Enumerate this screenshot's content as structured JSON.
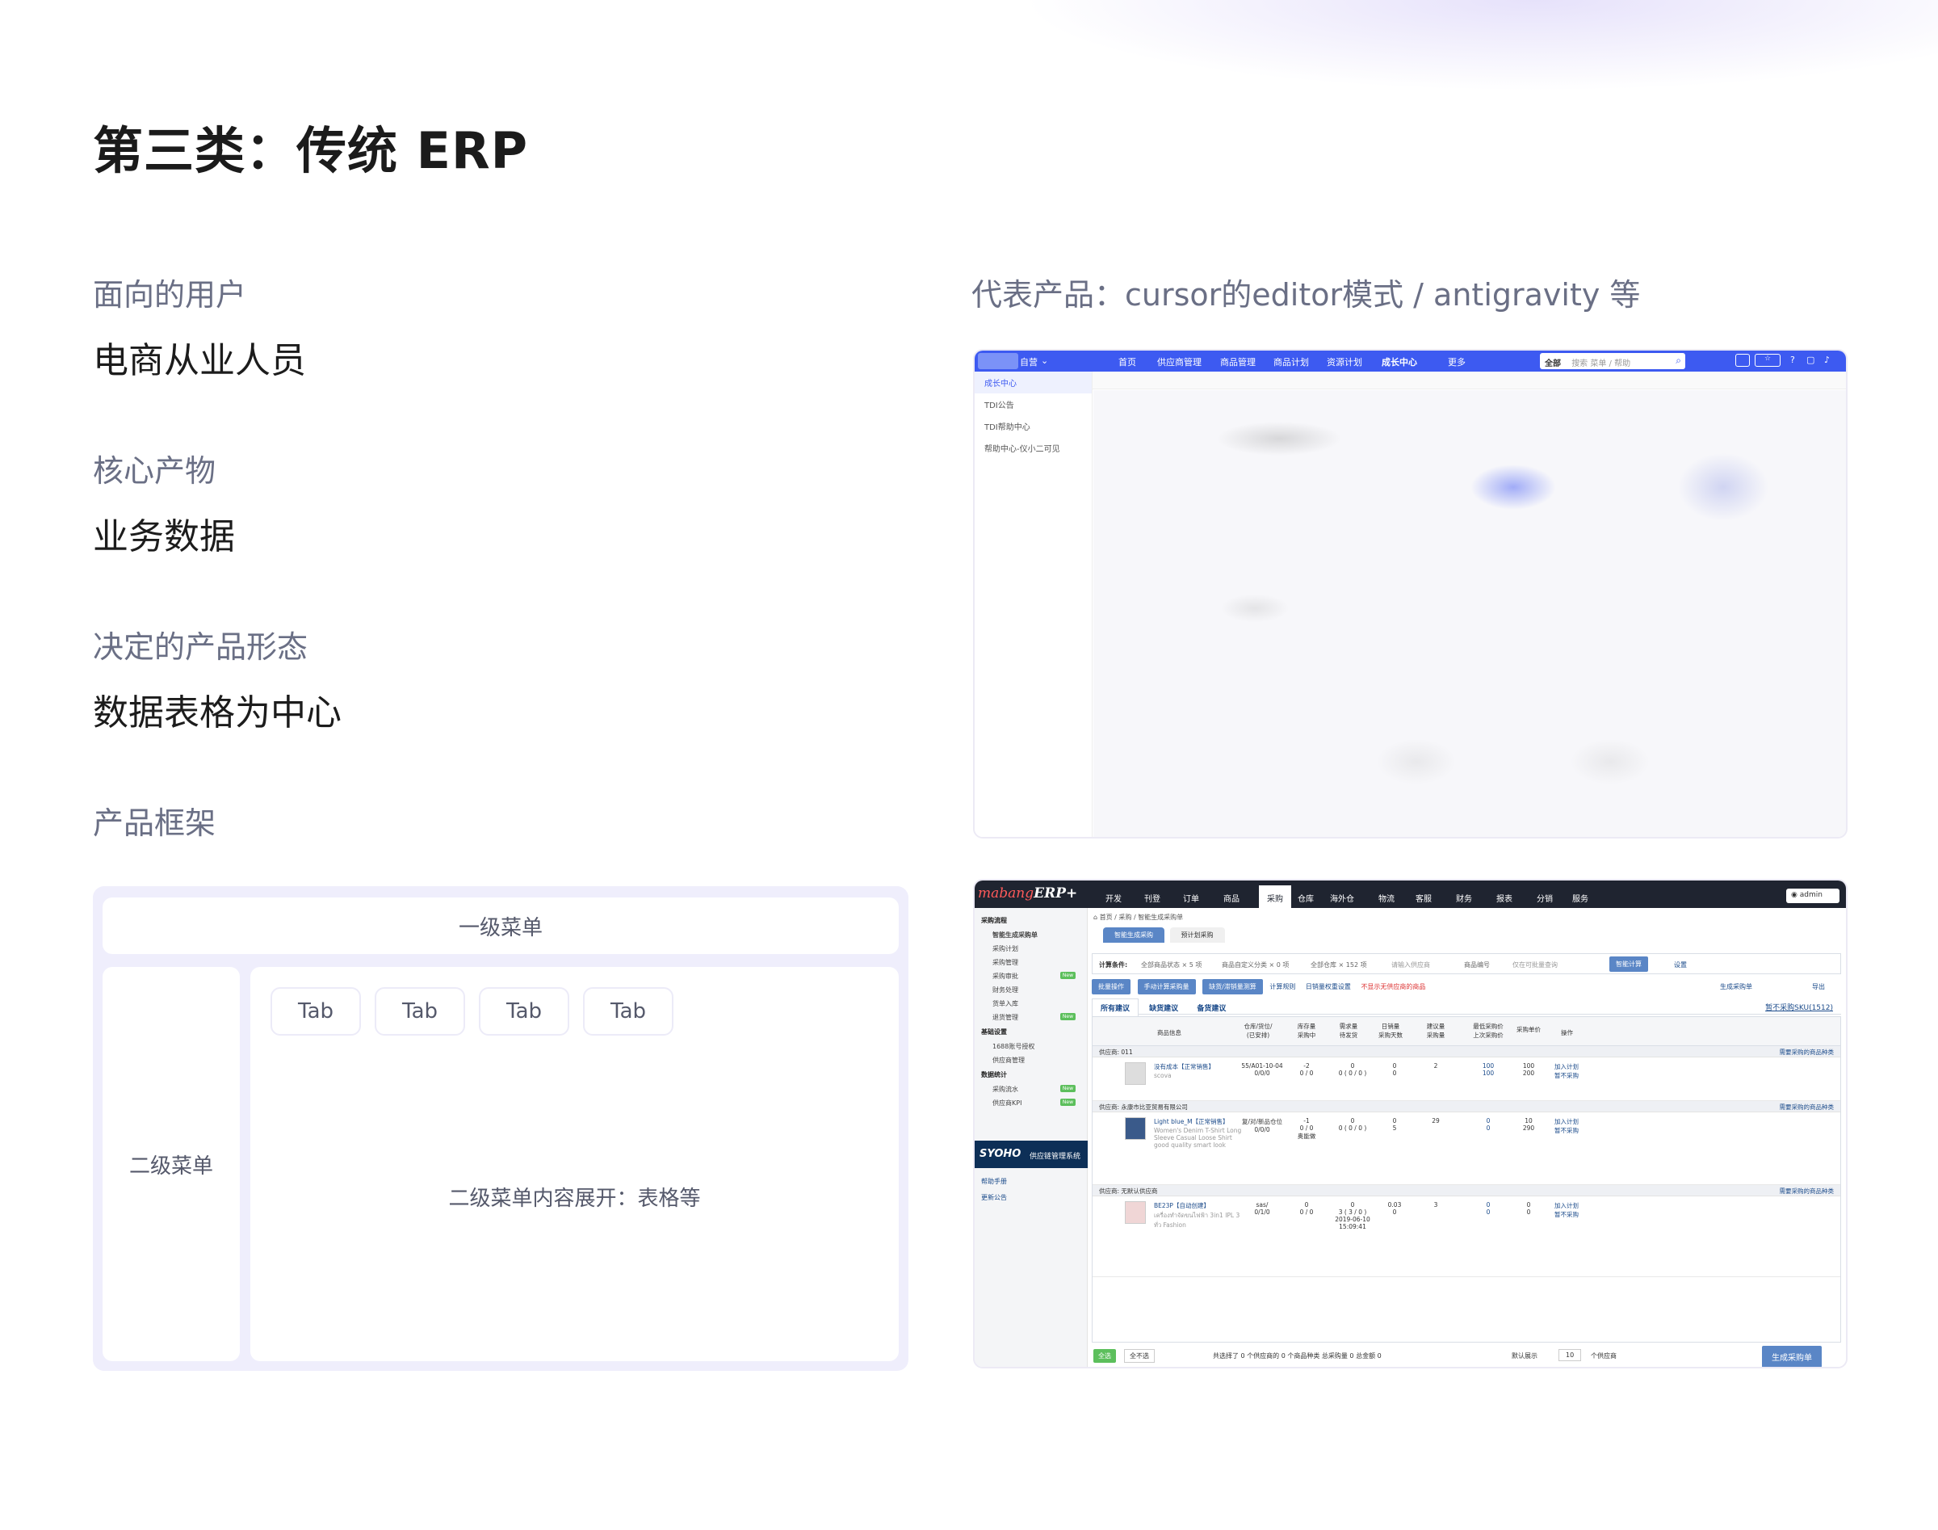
{
  "page": {
    "title": "第三类：传统 ERP",
    "users_label": "面向的用户",
    "users_value": "电商从业人员",
    "output_label": "核心产物",
    "output_value": "业务数据",
    "form_label": "决定的产品形态",
    "form_value": "数据表格为中心",
    "framework_label": "产品框架",
    "rep_label": "代表产品：cursor的editor模式 /  antigravity 等"
  },
  "framework": {
    "top_menu": "一级菜单",
    "side_menu": "二级菜单",
    "tabs": [
      "Tab",
      "Tab",
      "Tab",
      "Tab"
    ],
    "content": "二级菜单内容展开：表格等"
  },
  "shot1": {
    "brand": "自营",
    "nav": [
      "首页",
      "供应商管理",
      "商品管理",
      "商品计划",
      "资源计划",
      "成长中心",
      "更多"
    ],
    "scope": "全部",
    "search_placeholder": "搜索 菜单 / 帮助",
    "side_items": [
      "成长中心",
      "TDI公告",
      "TDI帮助中心",
      "帮助中心-仪小二可见"
    ]
  },
  "shot2": {
    "logo_a": "mabang",
    "logo_b": "ERP+",
    "nav": [
      "开发",
      "刊登",
      "订单",
      "商品",
      "采购",
      "仓库",
      "海外仓",
      "物流",
      "客服",
      "财务",
      "报表",
      "分销",
      "服务"
    ],
    "admin": "admin",
    "side": {
      "g1": "采购流程",
      "g1_items": [
        "智能生成采购单",
        "采购计划",
        "采购管理",
        "采购审批",
        "财务处理",
        "货单入库",
        "退货管理"
      ],
      "g2": "基础设置",
      "g2_items": [
        "1688账号授权",
        "供应商管理"
      ],
      "g3": "数据统计",
      "g3_items": [
        "采购流水",
        "供应商KPI"
      ],
      "new_badge": "New",
      "syoho": "供应链管理系统",
      "syoho_brand": "SYOHO",
      "link1": "帮助手册",
      "link2": "更新公告"
    },
    "crumb": [
      "首页",
      "采购",
      "智能生成采购单"
    ],
    "page_tabs": [
      "智能生成采购",
      "预计划采购"
    ],
    "conditions": {
      "label": "计算条件:",
      "items": [
        "全部商品状态 × 5 项",
        "商品自定义分类 × 0 项",
        "全部仓库 × 152 项",
        "请输入供应商",
        "商品编号",
        "仅在可批量查询"
      ],
      "calc": "智能计算",
      "settings": "设置"
    },
    "buttons": [
      "批量操作",
      "手动计算采购量",
      "缺货/滞销量测算"
    ],
    "links": [
      "计算规则",
      "日销量权重设置",
      "不显示无供应商的商品"
    ],
    "exports": [
      "生成采购单",
      "导出"
    ],
    "sub_tabs": [
      "所有建议",
      "缺货建议",
      "备货建议"
    ],
    "sub_right": "暂不采购SKU(1512)",
    "headers": [
      "商品信息",
      "仓库/货位/\n(已安排)",
      "库存量\n采购中",
      "需求量\n待发货",
      "日销量\n采购天数",
      "建议量\n采购量",
      "最低采购价\n上次采购价",
      "采购单价",
      "操作"
    ],
    "groups": [
      {
        "name": "供应商: 011",
        "right": "需要采购的商品种类"
      },
      {
        "name": "供应商: 永康市比亚贸易有限公司",
        "right": "需要采购的商品种类"
      },
      {
        "name": "供应商: 无默认供应商",
        "right": "需要采购的商品种类"
      }
    ],
    "rows": [
      {
        "name": "没有成本【正常销售】",
        "sub": "scova",
        "wh": "55/A01-10-04\n0/0/0",
        "stock": "-2\n0 / 0",
        "need": "0\n0 ( 0 / 0 )",
        "daily": "0\n0",
        "sug": "2",
        "price": "100\n100",
        "unit": "100\n200",
        "act": "加入计划\n暂不采购"
      },
      {
        "name": "Light blue_M【正常销售】",
        "sub": "Women's Denim T-Shirt Long Sleeve Casual Loose Shirt good quality smart look",
        "wh": "复/对/新品仓位\n0/0/0",
        "stock": "-1\n0 / 0\n奥能做",
        "need": "0\n0 ( 0 / 0 )",
        "daily": "0\n5",
        "sug": "29",
        "price": "0\n0",
        "unit": "10\n290",
        "act": "加入计划\n暂不采购"
      },
      {
        "name": "BE23P【自动创建】",
        "sub": "เครื่องทำจัดขนไฟฟ้า 3in1 IPL 3 ทั่ว Fashion",
        "wh": "sas/\n0/1/0",
        "stock": "0\n0 / 0",
        "need": "0\n3 ( 3 / 0 )\n2019-06-10 15:09:41",
        "daily": "0.03\n0",
        "sug": "3",
        "price": "0\n0",
        "unit": "0\n0",
        "act": "加入计划\n暂不采购"
      }
    ],
    "footer": {
      "all": "全选",
      "none": "全不选",
      "summary": "共选择了 0 个供应商的  0 个商品种类  总采购量 0  总金额 0",
      "default": "默认展示",
      "count": "10",
      "suffix": "个供应商",
      "generate": "生成采购单"
    }
  }
}
